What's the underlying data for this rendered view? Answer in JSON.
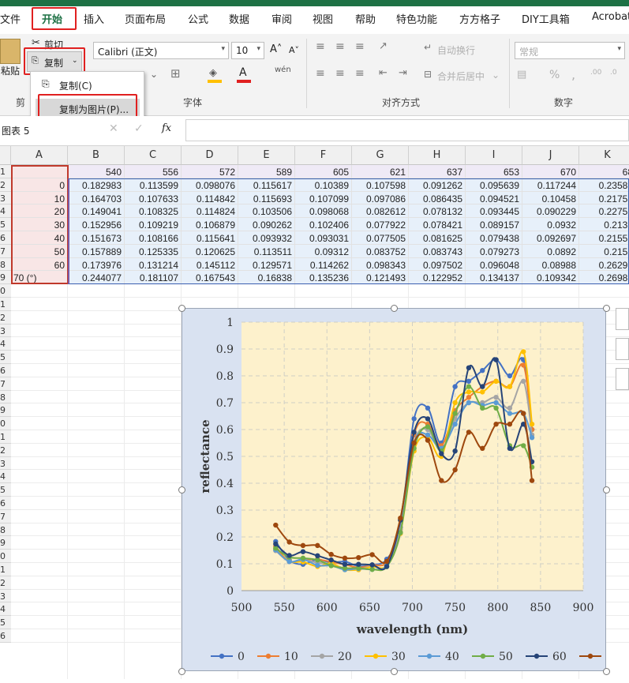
{
  "tabs": [
    "文件",
    "开始",
    "插入",
    "页面布局",
    "公式",
    "数据",
    "审阅",
    "视图",
    "帮助",
    "特色功能",
    "方方格子",
    "DIY工具箱",
    "Acrobat"
  ],
  "active_tab": "开始",
  "ribbon": {
    "cut_label": "剪切",
    "copy_label": "复制",
    "paste_label": "粘贴",
    "clipboard_group": "剪",
    "font_name": "Calibri (正文)",
    "font_size": "10",
    "font_group": "字体",
    "wrap_text": "自动换行",
    "merge_center": "合并后居中",
    "alignment_group": "对齐方式",
    "number_format": "常规",
    "number_group": "数字",
    "percent": "%",
    "comma": ","
  },
  "copy_menu": {
    "items": [
      "复制(C)",
      "复制为图片(P)..."
    ]
  },
  "formula_bar": {
    "name_box": "图表 5",
    "fx": "fx",
    "content": ""
  },
  "sheet": {
    "columns": [
      "A",
      "B",
      "C",
      "D",
      "E",
      "F",
      "G",
      "H",
      "I",
      "J",
      "K"
    ],
    "row_numbers": [
      "1",
      "2",
      "3",
      "4",
      "5",
      "6",
      "7",
      "8",
      "9",
      "0",
      "1",
      "2",
      "3",
      "4",
      "5",
      "6",
      "7",
      "8",
      "9",
      "0",
      "1",
      "2",
      "3",
      "4",
      "5",
      "6",
      "7",
      "8",
      "9",
      "0",
      "1",
      "2",
      "3",
      "4",
      "5",
      "6"
    ],
    "header_row": [
      "",
      "540",
      "556",
      "572",
      "589",
      "605",
      "621",
      "637",
      "653",
      "670",
      "68"
    ],
    "rows": [
      [
        "0",
        "0.182983",
        "0.113599",
        "0.098076",
        "0.115617",
        "0.10389",
        "0.107598",
        "0.091262",
        "0.095639",
        "0.117244",
        "0.23586"
      ],
      [
        "10",
        "0.164703",
        "0.107633",
        "0.114842",
        "0.115693",
        "0.107099",
        "0.097086",
        "0.086435",
        "0.094521",
        "0.10458",
        "0.21753"
      ],
      [
        "20",
        "0.149041",
        "0.108325",
        "0.114824",
        "0.103506",
        "0.098068",
        "0.082612",
        "0.078132",
        "0.093445",
        "0.090229",
        "0.22756"
      ],
      [
        "30",
        "0.152956",
        "0.109219",
        "0.106879",
        "0.090262",
        "0.102406",
        "0.077922",
        "0.078421",
        "0.089157",
        "0.0932",
        "0.2132"
      ],
      [
        "40",
        "0.151673",
        "0.108166",
        "0.115641",
        "0.093932",
        "0.093031",
        "0.077505",
        "0.081625",
        "0.079438",
        "0.092697",
        "0.21551"
      ],
      [
        "50",
        "0.157889",
        "0.125335",
        "0.120625",
        "0.113511",
        "0.09312",
        "0.083752",
        "0.083743",
        "0.079273",
        "0.0892",
        "0.2155"
      ],
      [
        "60",
        "0.173976",
        "0.131214",
        "0.145112",
        "0.129571",
        "0.114262",
        "0.098343",
        "0.097502",
        "0.096048",
        "0.08988",
        "0.26299"
      ],
      [
        "70   (°)",
        "0.244077",
        "0.181107",
        "0.167543",
        "0.16838",
        "0.135236",
        "0.121493",
        "0.122952",
        "0.134137",
        "0.109342",
        "0.26988"
      ]
    ]
  },
  "chart_data": {
    "type": "line",
    "xlabel": "wavelength (nm)",
    "ylabel": "reflectance",
    "xlim": [
      500,
      900
    ],
    "ylim": [
      0,
      1
    ],
    "x_ticks": [
      "500",
      "550",
      "600",
      "650",
      "700",
      "750",
      "800",
      "850",
      "900"
    ],
    "y_ticks": [
      "0",
      "0.1",
      "0.2",
      "0.3",
      "0.4",
      "0.5",
      "0.6",
      "0.7",
      "0.8",
      "0.9",
      "1"
    ],
    "grid": true,
    "legend_position": "bottom",
    "legend_suffix": "(°)",
    "x": [
      540,
      556,
      572,
      589,
      605,
      621,
      637,
      653,
      670,
      686,
      702,
      718,
      734,
      750,
      766,
      782,
      798,
      814,
      830,
      840
    ],
    "series": [
      {
        "name": "0",
        "color": "#4472c4",
        "values": [
          0.183,
          0.114,
          0.098,
          0.116,
          0.104,
          0.108,
          0.091,
          0.096,
          0.117,
          0.236,
          0.64,
          0.68,
          0.55,
          0.76,
          0.78,
          0.82,
          0.86,
          0.8,
          0.86,
          0.6
        ]
      },
      {
        "name": "10",
        "color": "#ed7d31",
        "values": [
          0.165,
          0.108,
          0.115,
          0.116,
          0.107,
          0.097,
          0.086,
          0.095,
          0.105,
          0.218,
          0.58,
          0.62,
          0.54,
          0.67,
          0.72,
          0.76,
          0.78,
          0.76,
          0.84,
          0.6
        ]
      },
      {
        "name": "20",
        "color": "#a5a5a5",
        "values": [
          0.149,
          0.108,
          0.115,
          0.104,
          0.098,
          0.083,
          0.078,
          0.093,
          0.09,
          0.228,
          0.55,
          0.6,
          0.52,
          0.64,
          0.7,
          0.7,
          0.72,
          0.68,
          0.78,
          0.58
        ]
      },
      {
        "name": "30",
        "color": "#ffc000",
        "values": [
          0.153,
          0.109,
          0.107,
          0.09,
          0.102,
          0.078,
          0.078,
          0.089,
          0.093,
          0.213,
          0.52,
          0.57,
          0.5,
          0.7,
          0.74,
          0.74,
          0.78,
          0.76,
          0.89,
          0.62
        ]
      },
      {
        "name": "40",
        "color": "#5b9bd5",
        "values": [
          0.152,
          0.108,
          0.116,
          0.094,
          0.093,
          0.078,
          0.082,
          0.079,
          0.093,
          0.216,
          0.55,
          0.58,
          0.53,
          0.62,
          0.7,
          0.69,
          0.7,
          0.66,
          0.66,
          0.57
        ]
      },
      {
        "name": "50",
        "color": "#70ad47",
        "values": [
          0.158,
          0.125,
          0.121,
          0.114,
          0.093,
          0.084,
          0.084,
          0.079,
          0.089,
          0.216,
          0.53,
          0.61,
          0.52,
          0.66,
          0.76,
          0.68,
          0.68,
          0.54,
          0.54,
          0.46
        ]
      },
      {
        "name": "60",
        "color": "#264478",
        "values": [
          0.174,
          0.131,
          0.145,
          0.13,
          0.114,
          0.098,
          0.098,
          0.096,
          0.09,
          0.263,
          0.59,
          0.64,
          0.51,
          0.52,
          0.83,
          0.76,
          0.86,
          0.53,
          0.62,
          0.48
        ]
      },
      {
        "name": "70",
        "color": "#9e480e",
        "values": [
          0.244,
          0.181,
          0.168,
          0.168,
          0.135,
          0.121,
          0.123,
          0.134,
          0.109,
          0.27,
          0.55,
          0.56,
          0.41,
          0.45,
          0.59,
          0.53,
          0.62,
          0.62,
          0.66,
          0.41
        ]
      }
    ]
  }
}
